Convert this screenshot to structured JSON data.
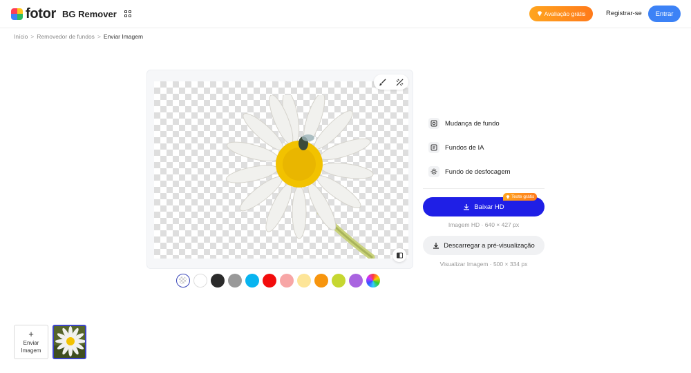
{
  "header": {
    "logo_text": "fotor",
    "app_name": "BG Remover",
    "trial_label": "Avaliação grátis",
    "register_label": "Registrar-se",
    "login_label": "Entrar",
    "brand_colors": [
      "#ff3d55",
      "#ffc41a",
      "#2dbb5f",
      "#3c82f6"
    ]
  },
  "breadcrumb": {
    "items": [
      "Início",
      "Removedor de fundos",
      "Enviar Imagem"
    ],
    "separator": ">"
  },
  "canvas": {
    "tools": [
      "brush-icon",
      "magic-erase-icon"
    ],
    "compare_icon": "compare-icon"
  },
  "swatches": [
    {
      "name": "transparent",
      "color": "transparent"
    },
    {
      "name": "white",
      "color": "#ffffff"
    },
    {
      "name": "black",
      "color": "#2b2b2b"
    },
    {
      "name": "gray",
      "color": "#999999"
    },
    {
      "name": "cyan",
      "color": "#08b4f0"
    },
    {
      "name": "red",
      "color": "#f20c0c"
    },
    {
      "name": "pink",
      "color": "#f7a6a6"
    },
    {
      "name": "light-yellow",
      "color": "#fde598"
    },
    {
      "name": "orange",
      "color": "#f7950e"
    },
    {
      "name": "lime",
      "color": "#c6d731"
    },
    {
      "name": "purple",
      "color": "#a964e0"
    },
    {
      "name": "rainbow",
      "color": "conic"
    }
  ],
  "side": {
    "options": [
      {
        "label": "Mudança de fundo",
        "icon": "background-change-icon"
      },
      {
        "label": "Fundos de IA",
        "icon": "ai-background-icon"
      },
      {
        "label": "Fundo de desfocagem",
        "icon": "blur-background-icon"
      }
    ],
    "hd_button": "Baixar HD",
    "free_badge": "Teste grátis",
    "hd_info": "Imagem HD · 640 × 427 px",
    "preview_button": "Descarregar a pré-visualização",
    "preview_info": "Visualizar Imagem · 500 × 334 px"
  },
  "bottom": {
    "upload_label_line1": "Enviar",
    "upload_label_line2": "Imagem",
    "plus": "+"
  }
}
